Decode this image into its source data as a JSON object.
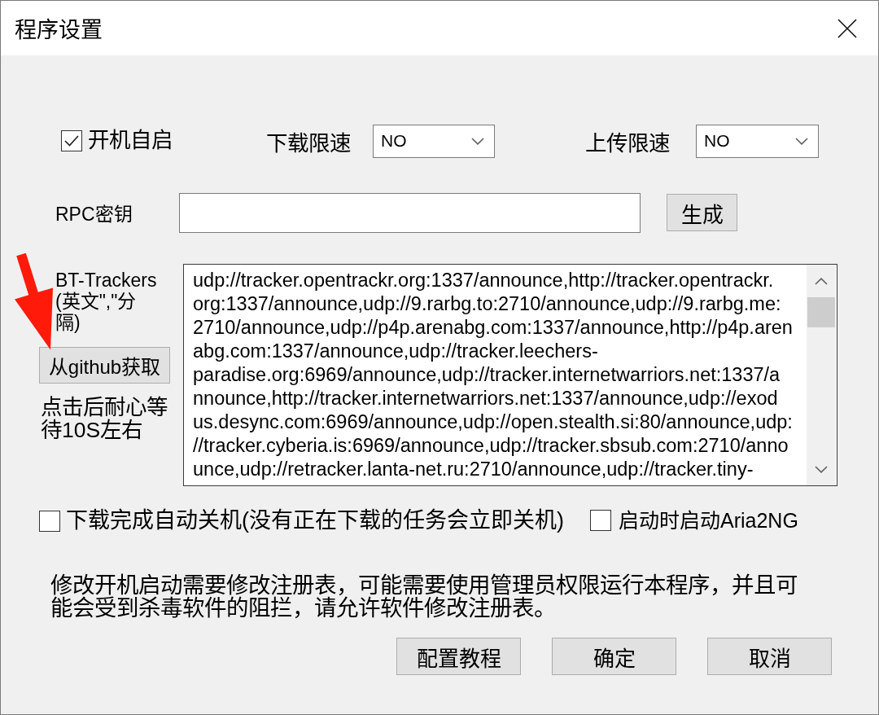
{
  "window": {
    "title": "程序设置"
  },
  "settings": {
    "autostart": {
      "label": "开机自启",
      "checked": true
    },
    "download_limit": {
      "label": "下载限速",
      "value": "NO"
    },
    "upload_limit": {
      "label": "上传限速",
      "value": "NO"
    }
  },
  "rpc_secret": {
    "label": "RPC密钥",
    "button": "生成"
  },
  "trackers": {
    "label_lines": [
      "BT-Trackers",
      "(英文\",\"分",
      "隔)"
    ],
    "fetch_button": "从github获取",
    "hint": "点击后耐心等待10S左右",
    "value_lines": [
      "udp://tracker.opentrackr.org:1337/announce,http://tracker.opentrackr.",
      "org:1337/announce,udp://9.rarbg.to:2710/announce,udp://9.rarbg.me:",
      "2710/announce,udp://p4p.arenabg.com:1337/announce,http://p4p.aren",
      "abg.com:1337/announce,udp://tracker.leechers-",
      "paradise.org:6969/announce,udp://tracker.internetwarriors.net:1337/a",
      "nnounce,http://tracker.internetwarriors.net:1337/announce,udp://exod",
      "us.desync.com:6969/announce,udp://open.stealth.si:80/announce,udp:",
      "//tracker.cyberia.is:6969/announce,udp://tracker.sbsub.com:2710/anno",
      "unce,udp://retracker.lanta-net.ru:2710/announce,udp://tracker.tiny-"
    ]
  },
  "options": [
    {
      "label": "下载完成自动关机(没有正在下载的任务会立即关机)",
      "checked": false
    },
    {
      "label": "启动时启动Aria2NG",
      "checked": false
    }
  ],
  "note": "修改开机启动需要修改注册表，可能需要使用管理员权限运行本程序，并且可能会受到杀毒软件的阻拦，请允许软件修改注册表。",
  "buttons": [
    "配置教程",
    "确定",
    "取消"
  ],
  "annotation_arrow": true
}
